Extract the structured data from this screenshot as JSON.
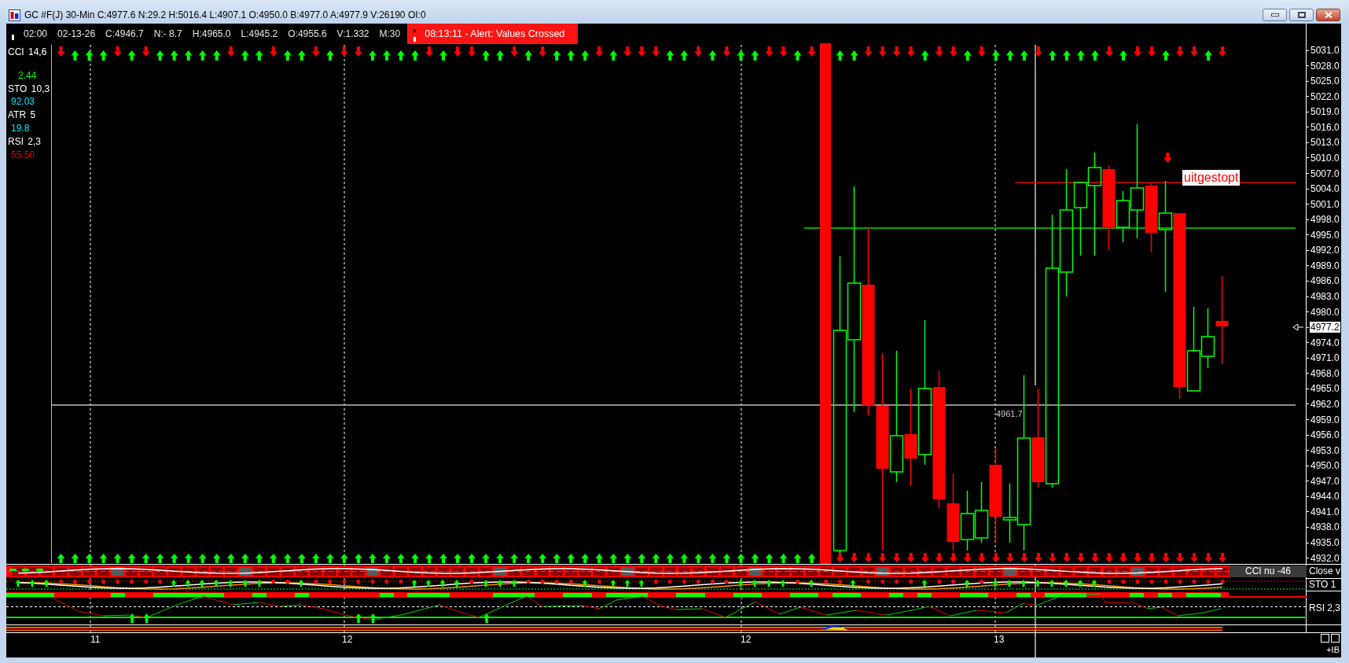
{
  "window": {
    "title": "GC #F(J) 30-Min C:4977.6 N:29.2 H:5016.4 L:4907.1 O:4950.0 B:4977.0 A:4977.9 V:26190 OI:0"
  },
  "header": {
    "fields": [
      "02:00",
      "02-13-26",
      "C:4946.7",
      "N:- 8.7",
      "H:4965.0",
      "L:4945.2",
      "O:4955.6",
      "V:1.332",
      "M:30"
    ],
    "alert": {
      "close": "×",
      "text": "08:13:11 - Alert: Values Crossed"
    }
  },
  "indicators": [
    {
      "name": "CCI 14,6",
      "value": "2.44",
      "color": "#00ff00"
    },
    {
      "name": "STO 10,3",
      "value": "92.03",
      "color": "#00e5ff"
    },
    {
      "name": "ATR 5",
      "value": "19.8",
      "color": "#00e5ff"
    },
    {
      "name": "RSI 2,3",
      "value": "55.50",
      "color": "#e00000"
    }
  ],
  "signals": {
    "top": [
      {
        "kind": "down"
      },
      {
        "kind": "up"
      },
      {
        "kind": "up"
      },
      {
        "kind": "up"
      },
      {
        "kind": "down"
      },
      {
        "kind": "up"
      },
      {
        "kind": "down"
      },
      {
        "kind": "up"
      },
      {
        "kind": "up"
      },
      {
        "kind": "up"
      },
      {
        "kind": "up"
      },
      {
        "kind": "up"
      },
      {
        "kind": "down"
      },
      {
        "kind": "up"
      },
      {
        "kind": "up"
      },
      {
        "kind": "down"
      },
      {
        "kind": "up"
      },
      {
        "kind": "up"
      },
      {
        "kind": "down"
      },
      {
        "kind": "up"
      },
      {
        "kind": "down"
      },
      {
        "kind": "down"
      },
      {
        "kind": "up"
      },
      {
        "kind": "up"
      },
      {
        "kind": "up"
      },
      {
        "kind": "up"
      },
      {
        "kind": "down"
      },
      {
        "kind": "up"
      },
      {
        "kind": "down"
      },
      {
        "kind": "down"
      },
      {
        "kind": "up"
      },
      {
        "kind": "up"
      },
      {
        "kind": "down"
      },
      {
        "kind": "up"
      },
      {
        "kind": "down"
      },
      {
        "kind": "up"
      },
      {
        "kind": "up"
      },
      {
        "kind": "up"
      },
      {
        "kind": "down"
      },
      {
        "kind": "up"
      },
      {
        "kind": "down"
      },
      {
        "kind": "down"
      },
      {
        "kind": "down"
      },
      {
        "kind": "up"
      },
      {
        "kind": "up"
      },
      {
        "kind": "down"
      },
      {
        "kind": "up"
      },
      {
        "kind": "down"
      },
      {
        "kind": "up"
      },
      {
        "kind": "up"
      },
      {
        "kind": "down"
      },
      {
        "kind": "down"
      },
      {
        "kind": "up"
      },
      {
        "kind": "down"
      },
      {
        "kind": "none"
      },
      {
        "kind": "up"
      },
      {
        "kind": "up"
      },
      {
        "kind": "down"
      },
      {
        "kind": "down"
      },
      {
        "kind": "down"
      },
      {
        "kind": "down"
      },
      {
        "kind": "up"
      },
      {
        "kind": "down"
      },
      {
        "kind": "down"
      },
      {
        "kind": "up"
      },
      {
        "kind": "down"
      },
      {
        "kind": "up"
      },
      {
        "kind": "up"
      },
      {
        "kind": "up"
      },
      {
        "kind": "down"
      },
      {
        "kind": "up"
      },
      {
        "kind": "up"
      },
      {
        "kind": "up"
      },
      {
        "kind": "up"
      },
      {
        "kind": "down"
      },
      {
        "kind": "up"
      },
      {
        "kind": "down"
      },
      {
        "kind": "down"
      },
      {
        "kind": "up"
      },
      {
        "kind": "down"
      },
      {
        "kind": "down"
      },
      {
        "kind": "up"
      },
      {
        "kind": "down"
      }
    ],
    "bottom": [
      {
        "kind": "up"
      },
      {
        "kind": "up"
      },
      {
        "kind": "up"
      },
      {
        "kind": "up"
      },
      {
        "kind": "up"
      },
      {
        "kind": "up"
      },
      {
        "kind": "up"
      },
      {
        "kind": "up"
      },
      {
        "kind": "up"
      },
      {
        "kind": "up"
      },
      {
        "kind": "up"
      },
      {
        "kind": "up"
      },
      {
        "kind": "up"
      },
      {
        "kind": "up"
      },
      {
        "kind": "up"
      },
      {
        "kind": "up"
      },
      {
        "kind": "up"
      },
      {
        "kind": "up"
      },
      {
        "kind": "up"
      },
      {
        "kind": "up"
      },
      {
        "kind": "up"
      },
      {
        "kind": "up"
      },
      {
        "kind": "up"
      },
      {
        "kind": "up"
      },
      {
        "kind": "up"
      },
      {
        "kind": "up"
      },
      {
        "kind": "up"
      },
      {
        "kind": "up"
      },
      {
        "kind": "up"
      },
      {
        "kind": "up"
      },
      {
        "kind": "up"
      },
      {
        "kind": "up"
      },
      {
        "kind": "up"
      },
      {
        "kind": "up"
      },
      {
        "kind": "up"
      },
      {
        "kind": "up"
      },
      {
        "kind": "up"
      },
      {
        "kind": "up"
      },
      {
        "kind": "up"
      },
      {
        "kind": "up"
      },
      {
        "kind": "up"
      },
      {
        "kind": "up"
      },
      {
        "kind": "up"
      },
      {
        "kind": "up"
      },
      {
        "kind": "up"
      },
      {
        "kind": "up"
      },
      {
        "kind": "up"
      },
      {
        "kind": "up"
      },
      {
        "kind": "up"
      },
      {
        "kind": "up"
      },
      {
        "kind": "up"
      },
      {
        "kind": "up"
      },
      {
        "kind": "up"
      },
      {
        "kind": "up"
      },
      {
        "kind": "none"
      },
      {
        "kind": "down"
      },
      {
        "kind": "down"
      },
      {
        "kind": "down"
      },
      {
        "kind": "down"
      },
      {
        "kind": "down"
      },
      {
        "kind": "down"
      },
      {
        "kind": "down"
      },
      {
        "kind": "down"
      },
      {
        "kind": "down"
      },
      {
        "kind": "down"
      },
      {
        "kind": "down"
      },
      {
        "kind": "down"
      },
      {
        "kind": "down"
      },
      {
        "kind": "down"
      },
      {
        "kind": "down"
      },
      {
        "kind": "down"
      },
      {
        "kind": "down"
      },
      {
        "kind": "down"
      },
      {
        "kind": "down"
      },
      {
        "kind": "down"
      },
      {
        "kind": "down"
      },
      {
        "kind": "down"
      },
      {
        "kind": "down"
      },
      {
        "kind": "down"
      },
      {
        "kind": "down"
      },
      {
        "kind": "down"
      },
      {
        "kind": "down"
      },
      {
        "kind": "down"
      }
    ]
  },
  "chart_labels": {
    "stop": "uitgestopt",
    "level": "4961.7"
  },
  "price_axis": [
    {
      "label": "5031.0",
      "kind": "tick"
    },
    {
      "label": "5028.0",
      "kind": "tick"
    },
    {
      "label": "5025.0",
      "kind": "tick"
    },
    {
      "label": "5022.0",
      "kind": "tick"
    },
    {
      "label": "5019.0",
      "kind": "tick"
    },
    {
      "label": "5016.0",
      "kind": "tick"
    },
    {
      "label": "5013.0",
      "kind": "tick"
    },
    {
      "label": "5010.0",
      "kind": "tick"
    },
    {
      "label": "5007.0",
      "kind": "tick"
    },
    {
      "label": "5004.0",
      "kind": "tick"
    },
    {
      "label": "5001.0",
      "kind": "tick"
    },
    {
      "label": "4998.0",
      "kind": "tick"
    },
    {
      "label": "4995.0",
      "kind": "tick"
    },
    {
      "label": "4992.0",
      "kind": "tick"
    },
    {
      "label": "4989.0",
      "kind": "tick"
    },
    {
      "label": "4986.0",
      "kind": "tick"
    },
    {
      "label": "4983.0",
      "kind": "tick"
    },
    {
      "label": "4980.0",
      "kind": "tick"
    },
    {
      "label": "4977.2",
      "kind": "current"
    },
    {
      "label": "4974.0",
      "kind": "tick"
    },
    {
      "label": "4971.0",
      "kind": "tick"
    },
    {
      "label": "4968.0",
      "kind": "tick"
    },
    {
      "label": "4965.0",
      "kind": "tick"
    },
    {
      "label": "4962.0",
      "kind": "tick"
    },
    {
      "label": "4959.0",
      "kind": "tick"
    },
    {
      "label": "4956.0",
      "kind": "tick"
    },
    {
      "label": "4953.0",
      "kind": "tick"
    },
    {
      "label": "4950.0",
      "kind": "tick"
    },
    {
      "label": "4947.0",
      "kind": "tick"
    },
    {
      "label": "4944.0",
      "kind": "tick"
    },
    {
      "label": "4941.0",
      "kind": "tick"
    },
    {
      "label": "4938.0",
      "kind": "tick"
    },
    {
      "label": "4935.0",
      "kind": "tick"
    },
    {
      "label": "4932.0",
      "kind": "tick"
    }
  ],
  "sub_panels": {
    "cci_readout": "CCI nu -46",
    "labels": [
      "Close v",
      "STO 1",
      "RSI 2,3"
    ]
  },
  "time_axis": [
    "11",
    "12",
    "12",
    "13"
  ],
  "corner": {
    "label": "+IB"
  }
}
